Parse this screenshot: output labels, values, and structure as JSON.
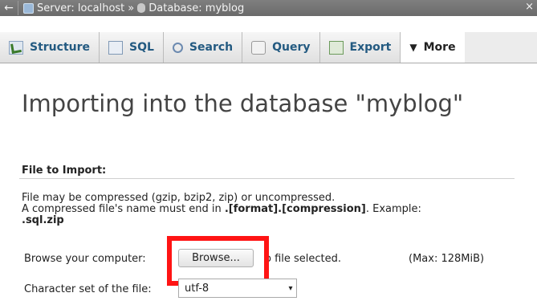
{
  "breadcrumb": {
    "back_glyph": "←",
    "server": "Server: localhost",
    "separator": "»",
    "database": "Database: myblog",
    "close_glyph": "×"
  },
  "tabs": [
    {
      "label": "Structure",
      "icon": "structure-icon"
    },
    {
      "label": "SQL",
      "icon": "sql-icon"
    },
    {
      "label": "Search",
      "icon": "search-icon"
    },
    {
      "label": "Query",
      "icon": "query-icon"
    },
    {
      "label": "Export",
      "icon": "export-icon"
    },
    {
      "label": "More",
      "icon": "triangle-down-icon"
    }
  ],
  "page": {
    "title": "Importing into the database \"myblog\"",
    "section_label": "File to Import:",
    "desc_line1": "File may be compressed (gzip, bzip2, zip) or uncompressed.",
    "desc_line2_prefix": "A compressed file's name must end in ",
    "desc_line2_bold": ".[format].[compression]",
    "desc_line2_suffix": ". Example:",
    "desc_line3": ".sql.zip"
  },
  "upload": {
    "label": "Browse your computer:",
    "button_label": "Browse...",
    "status": "o file selected.",
    "max": "(Max: 128MiB)"
  },
  "charset": {
    "label": "Character set of the file:",
    "value": "utf-8"
  },
  "colors": {
    "highlight": "#ff1414",
    "tab_text": "#235a81"
  }
}
